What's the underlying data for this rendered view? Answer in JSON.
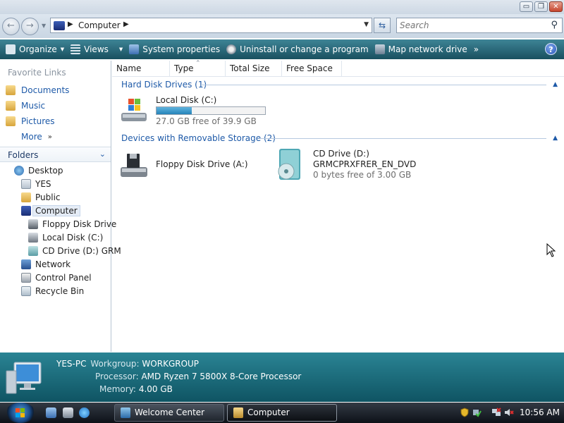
{
  "window": {
    "min_glyph": "▭",
    "max_glyph": "❐",
    "close_glyph": "✕"
  },
  "address": {
    "crumb": "Computer",
    "back_glyph": "←",
    "forward_glyph": "→"
  },
  "search": {
    "placeholder": "Search"
  },
  "toolbar": {
    "items": [
      {
        "label": "Organize",
        "icon": "organize-icon"
      },
      {
        "label": "Views",
        "icon": "views-icon"
      },
      {
        "label": "System properties",
        "icon": "system-properties-icon"
      },
      {
        "label": "Uninstall or change a program",
        "icon": "uninstall-icon"
      },
      {
        "label": "Map network drive",
        "icon": "map-drive-icon"
      }
    ],
    "overflow": "»",
    "help": "?"
  },
  "nav": {
    "favorites_header": "Favorite Links",
    "favorites": [
      {
        "label": "Documents"
      },
      {
        "label": "Music"
      },
      {
        "label": "Pictures"
      },
      {
        "label": "More"
      }
    ],
    "folders_header": "Folders",
    "tree": [
      {
        "label": "Desktop",
        "icon": "desktop-icon"
      },
      {
        "label": "YES",
        "icon": "user-folder-icon"
      },
      {
        "label": "Public",
        "icon": "public-folder-icon"
      },
      {
        "label": "Computer",
        "icon": "computer-icon"
      },
      {
        "label": "Floppy Disk Drive",
        "icon": "floppy-icon"
      },
      {
        "label": "Local Disk (C:)",
        "icon": "hard-disk-icon"
      },
      {
        "label": "CD Drive (D:) GRM",
        "icon": "cd-drive-icon"
      },
      {
        "label": "Network",
        "icon": "network-icon"
      },
      {
        "label": "Control Panel",
        "icon": "control-panel-icon"
      },
      {
        "label": "Recycle Bin",
        "icon": "recycle-bin-icon"
      }
    ]
  },
  "columns": [
    "Name",
    "Type",
    "Total Size",
    "Free Space"
  ],
  "groups": {
    "hard_disks": "Hard Disk Drives (1)",
    "removable": "Devices with Removable Storage (2)"
  },
  "drives": {
    "c": {
      "name": "Local Disk (C:)",
      "free": "27.0 GB free of 39.9 GB",
      "used_fraction": 0.323
    },
    "a": {
      "name": "Floppy Disk Drive (A:)"
    },
    "d": {
      "name": "CD Drive (D:)",
      "label": "GRMCPRXFRER_EN_DVD",
      "free": "0 bytes free of 3.00 GB"
    }
  },
  "details": {
    "computer_name": "YES-PC",
    "workgroup_label": "Workgroup:",
    "workgroup": "WORKGROUP",
    "processor_label": "Processor:",
    "processor": "AMD Ryzen 7 5800X 8-Core Processor",
    "memory_label": "Memory:",
    "memory": "4.00 GB"
  },
  "taskbar": {
    "tasks": [
      {
        "label": "Welcome Center"
      },
      {
        "label": "Computer"
      }
    ],
    "clock": "10:56 AM"
  }
}
